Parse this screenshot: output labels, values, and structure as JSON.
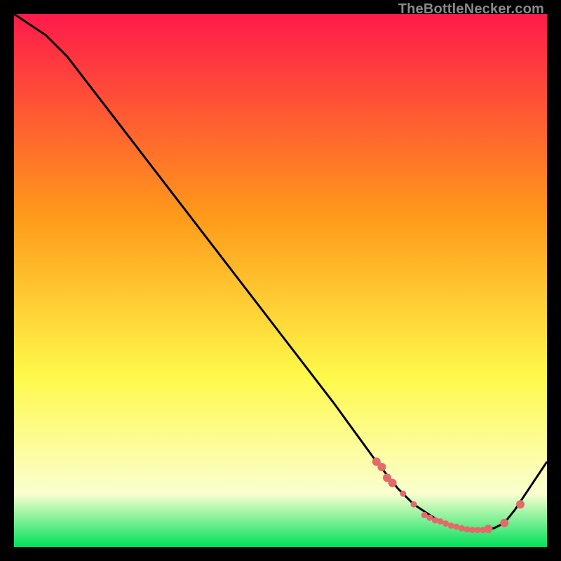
{
  "watermark": "TheBottleNecker.com",
  "colors": {
    "gradient_top": "#ff1a4b",
    "gradient_mid1": "#ff9a1a",
    "gradient_mid2": "#fff94a",
    "gradient_mid3": "#faffd0",
    "gradient_bottom": "#00e05a",
    "curve": "#000000",
    "marker": "#e46a6a",
    "bg": "#000000"
  },
  "chart_data": {
    "type": "line",
    "title": "",
    "xlabel": "",
    "ylabel": "",
    "xlim": [
      0,
      100
    ],
    "ylim": [
      0,
      100
    ],
    "curve": {
      "x": [
        0,
        6,
        10,
        20,
        30,
        40,
        50,
        60,
        68,
        72,
        75,
        78,
        80,
        82,
        84,
        86,
        88,
        90,
        92,
        94,
        100
      ],
      "y": [
        100,
        96,
        92,
        79,
        66,
        53,
        40,
        27,
        16,
        11,
        8,
        6,
        4.8,
        4,
        3.5,
        3.2,
        3.2,
        3.5,
        4.5,
        7,
        16
      ]
    },
    "markers": {
      "x": [
        68,
        69,
        70,
        71,
        73,
        75,
        77,
        78,
        79,
        80,
        81,
        82,
        83,
        84,
        85,
        86,
        87,
        88,
        89,
        92,
        95
      ],
      "y": [
        16,
        15,
        13,
        12,
        10,
        8,
        6,
        5.5,
        5,
        4.8,
        4.4,
        4,
        3.8,
        3.5,
        3.3,
        3.2,
        3.2,
        3.2,
        3.4,
        4.5,
        8
      ]
    }
  }
}
